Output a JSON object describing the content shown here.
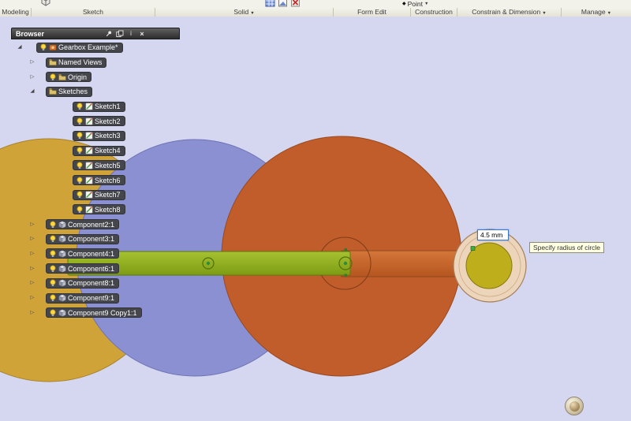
{
  "ribbon": {
    "tabs": [
      {
        "label": "Modeling"
      },
      {
        "label": "Sketch"
      },
      {
        "label": "Solid"
      },
      {
        "label": "Form Edit"
      },
      {
        "label": "Construction"
      },
      {
        "label": "Constrain & Dimension"
      },
      {
        "label": "Manage"
      }
    ],
    "point_label": "Point"
  },
  "browser": {
    "title": "Browser",
    "tree": [
      {
        "label": "Gearbox Example*"
      },
      {
        "label": "Named Views"
      },
      {
        "label": "Origin"
      },
      {
        "label": "Sketches"
      },
      {
        "label": "Sketch1"
      },
      {
        "label": "Sketch2"
      },
      {
        "label": "Sketch3"
      },
      {
        "label": "Sketch4"
      },
      {
        "label": "Sketch5"
      },
      {
        "label": "Sketch6"
      },
      {
        "label": "Sketch7"
      },
      {
        "label": "Sketch8"
      },
      {
        "label": "Component2:1"
      },
      {
        "label": "Component3:1"
      },
      {
        "label": "Component4:1"
      },
      {
        "label": "Component6:1"
      },
      {
        "label": "Component8:1"
      },
      {
        "label": "Component9:1"
      },
      {
        "label": "Component9 Copy1:1"
      }
    ]
  },
  "viewport": {
    "dimension_value": "4.5 mm",
    "tooltip": "Specify radius of circle",
    "colors": {
      "background": "#d5d6ef",
      "gear_yellow": "#d0a338",
      "gear_blue": "#8a90d2",
      "gear_orange": "#c15c2b",
      "shaft_green": "#8fae1c",
      "shaft_orange": "#ca682e",
      "small_gear_ring": "#edd5bc",
      "small_gear_yellow": "#bfae1c"
    }
  },
  "icons": {
    "dropdown_caret": "▼",
    "point_marker": "◆",
    "expand_collapsed": "▷",
    "expand_expanded": "◢",
    "close": "×",
    "info": "i"
  }
}
